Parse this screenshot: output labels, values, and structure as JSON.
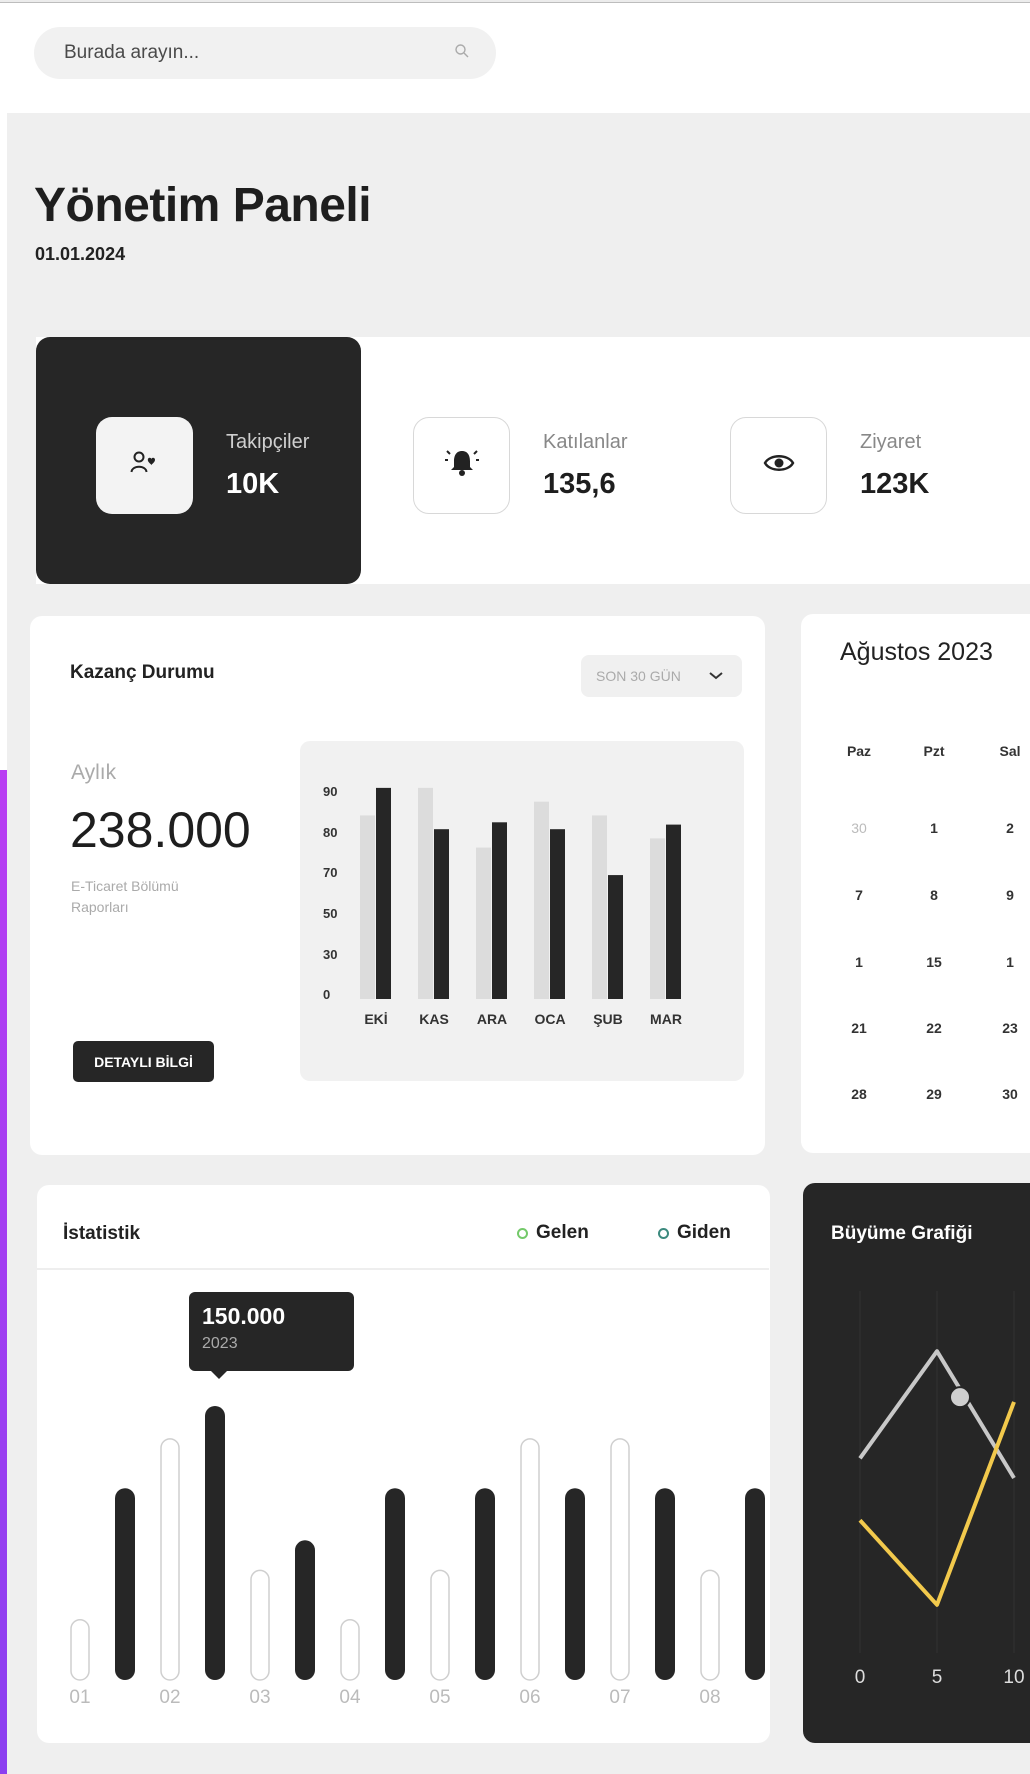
{
  "search": {
    "placeholder": "Burada arayın..."
  },
  "page": {
    "title": "Yönetim Paneli",
    "date": "01.01.2024"
  },
  "stats": [
    {
      "label": "Takipçiler",
      "value": "10K",
      "icon": "user-heart-icon"
    },
    {
      "label": "Katılanlar",
      "value": "135,6",
      "icon": "bell-icon"
    },
    {
      "label": "Ziyaret",
      "value": "123K",
      "icon": "eye-icon"
    }
  ],
  "earnings": {
    "title": "Kazanç Durumu",
    "period_select": "SON 30 GÜN",
    "period_label": "Aylık",
    "value": "238.000",
    "subtitle": "E-Ticaret Bölümü Raporları",
    "button_label": "DETAYLI BİLGİ"
  },
  "calendar": {
    "title": "Ağustos 2023",
    "weekdays": [
      "Paz",
      "Pzt",
      "Sal"
    ],
    "weeks": [
      [
        "30",
        "1",
        "2"
      ],
      [
        "7",
        "8",
        "9"
      ],
      [
        "1",
        "15",
        "1"
      ],
      [
        "21",
        "22",
        "23"
      ],
      [
        "28",
        "29",
        "30"
      ]
    ]
  },
  "statistics": {
    "title": "İstatistik",
    "legend": [
      "Gelen",
      "Giden"
    ],
    "tooltip": {
      "value": "150.000",
      "year": "2023"
    }
  },
  "growth": {
    "title": "Büyüme Grafiği"
  },
  "chart_data": [
    {
      "type": "bar",
      "categories": [
        "EKİ",
        "KAS",
        "ARA",
        "OCA",
        "ŞUB",
        "MAR"
      ],
      "yticks": [
        "90",
        "80",
        "70",
        "50",
        "30",
        "0"
      ],
      "series": [
        {
          "values": [
            80,
            92,
            66,
            86,
            80,
            70
          ],
          "color": "#dcdcdc"
        },
        {
          "values": [
            92,
            74,
            77,
            74,
            54,
            76
          ],
          "color": "#262626"
        }
      ]
    },
    {
      "type": "bar",
      "categories": [
        "01",
        "02",
        "03",
        "04",
        "05",
        "06",
        "07",
        "08"
      ],
      "series": [
        {
          "name": "Gelen",
          "style": "outline",
          "values": [
            22,
            88,
            40,
            22,
            40,
            88,
            88,
            40
          ]
        },
        {
          "name": "Giden",
          "style": "filled",
          "values": [
            70,
            100,
            51,
            70,
            70,
            70,
            70,
            70
          ]
        }
      ],
      "ylim": [
        0,
        100
      ]
    },
    {
      "type": "line",
      "x": [
        0,
        5,
        10
      ],
      "xticks": [
        "0",
        "5",
        "10"
      ],
      "series": [
        {
          "color": "#c8c8c8",
          "values": [
            62,
            100,
            55
          ]
        },
        {
          "color": "#f2c94c",
          "values": [
            40,
            10,
            82
          ]
        }
      ],
      "ylim": [
        0,
        110
      ]
    }
  ]
}
